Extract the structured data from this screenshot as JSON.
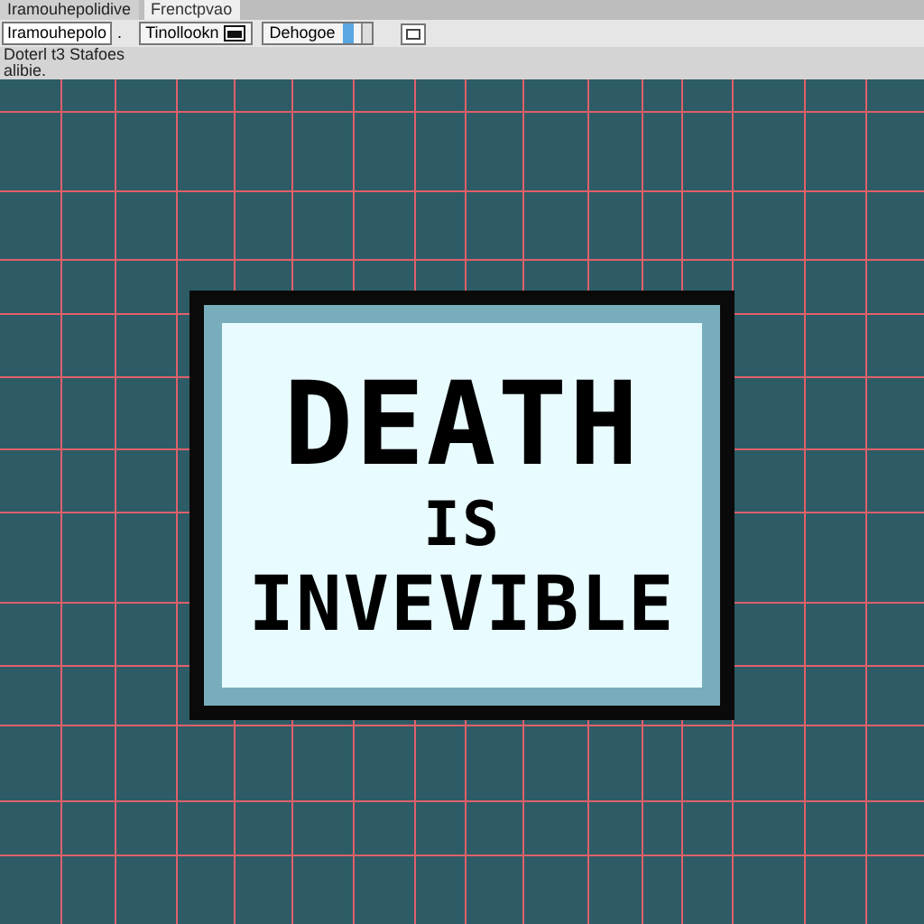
{
  "tabs": [
    {
      "label": "Iramouhepolidive",
      "selected": false
    },
    {
      "label": "Frenctpvao",
      "selected": true
    }
  ],
  "toolbar": {
    "field": "Iramouhepolo",
    "separator": ".",
    "tool": "Tinollookn",
    "dropdown": "Dehogoe"
  },
  "info_lines": [
    "Doterl t3 Stafoes",
    "alibie."
  ],
  "sign": {
    "lines": [
      "DEATH",
      "IS",
      "INVEVIBLE"
    ]
  }
}
